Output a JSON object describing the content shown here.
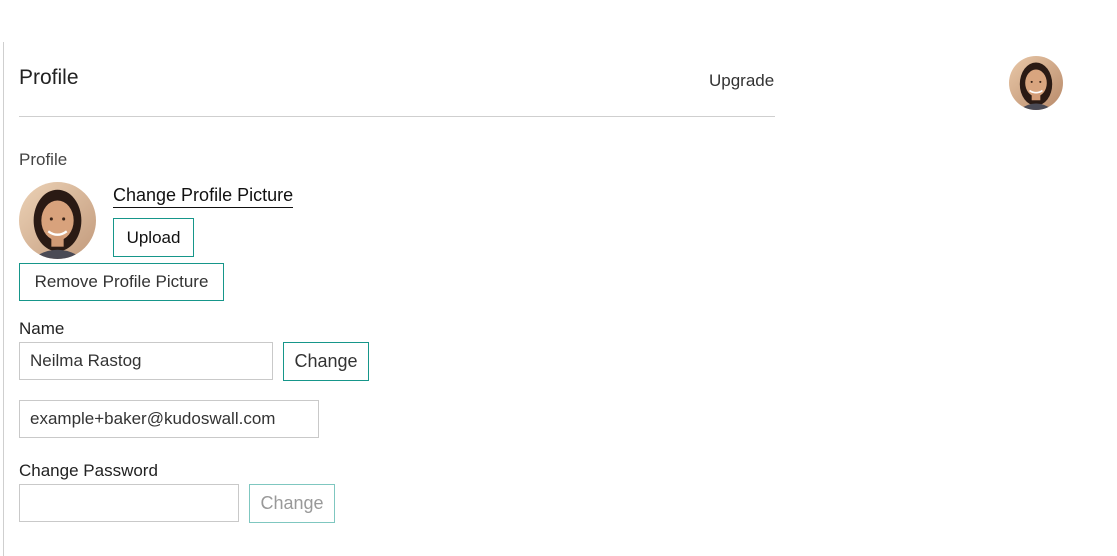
{
  "header": {
    "title": "Profile",
    "upgrade_label": "Upgrade"
  },
  "profile": {
    "section_label": "Profile",
    "change_picture_label": "Change Profile Picture",
    "upload_label": "Upload",
    "remove_picture_label": "Remove Profile Picture"
  },
  "name": {
    "label": "Name",
    "value": "Neilma Rastog",
    "change_label": "Change"
  },
  "email": {
    "value": "example+baker@kudoswall.com"
  },
  "password": {
    "label": "Change Password",
    "value": "",
    "change_label": "Change"
  },
  "colors": {
    "accent": "#16968a",
    "accent_disabled": "#7fc7c0",
    "divider": "#cfcfcf"
  }
}
